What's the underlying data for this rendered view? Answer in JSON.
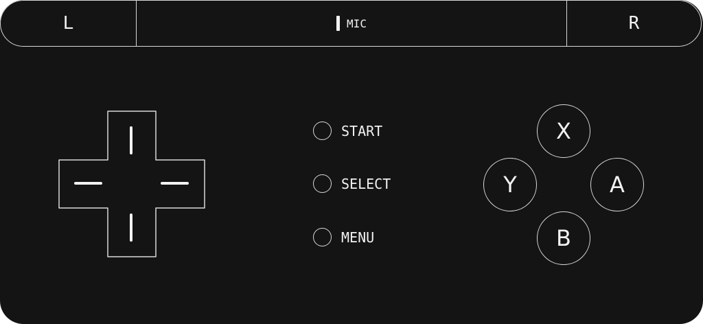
{
  "shoulders": {
    "left_label": "L",
    "right_label": "R"
  },
  "mic": {
    "label": "MIC"
  },
  "menu_buttons": [
    {
      "label": "START"
    },
    {
      "label": "SELECT"
    },
    {
      "label": "MENU"
    }
  ],
  "face_buttons": {
    "x": "X",
    "y": "Y",
    "a": "A",
    "b": "B"
  },
  "colors": {
    "background": "#141414",
    "outline": "#d9d9d9",
    "text": "#f2f2f2"
  }
}
